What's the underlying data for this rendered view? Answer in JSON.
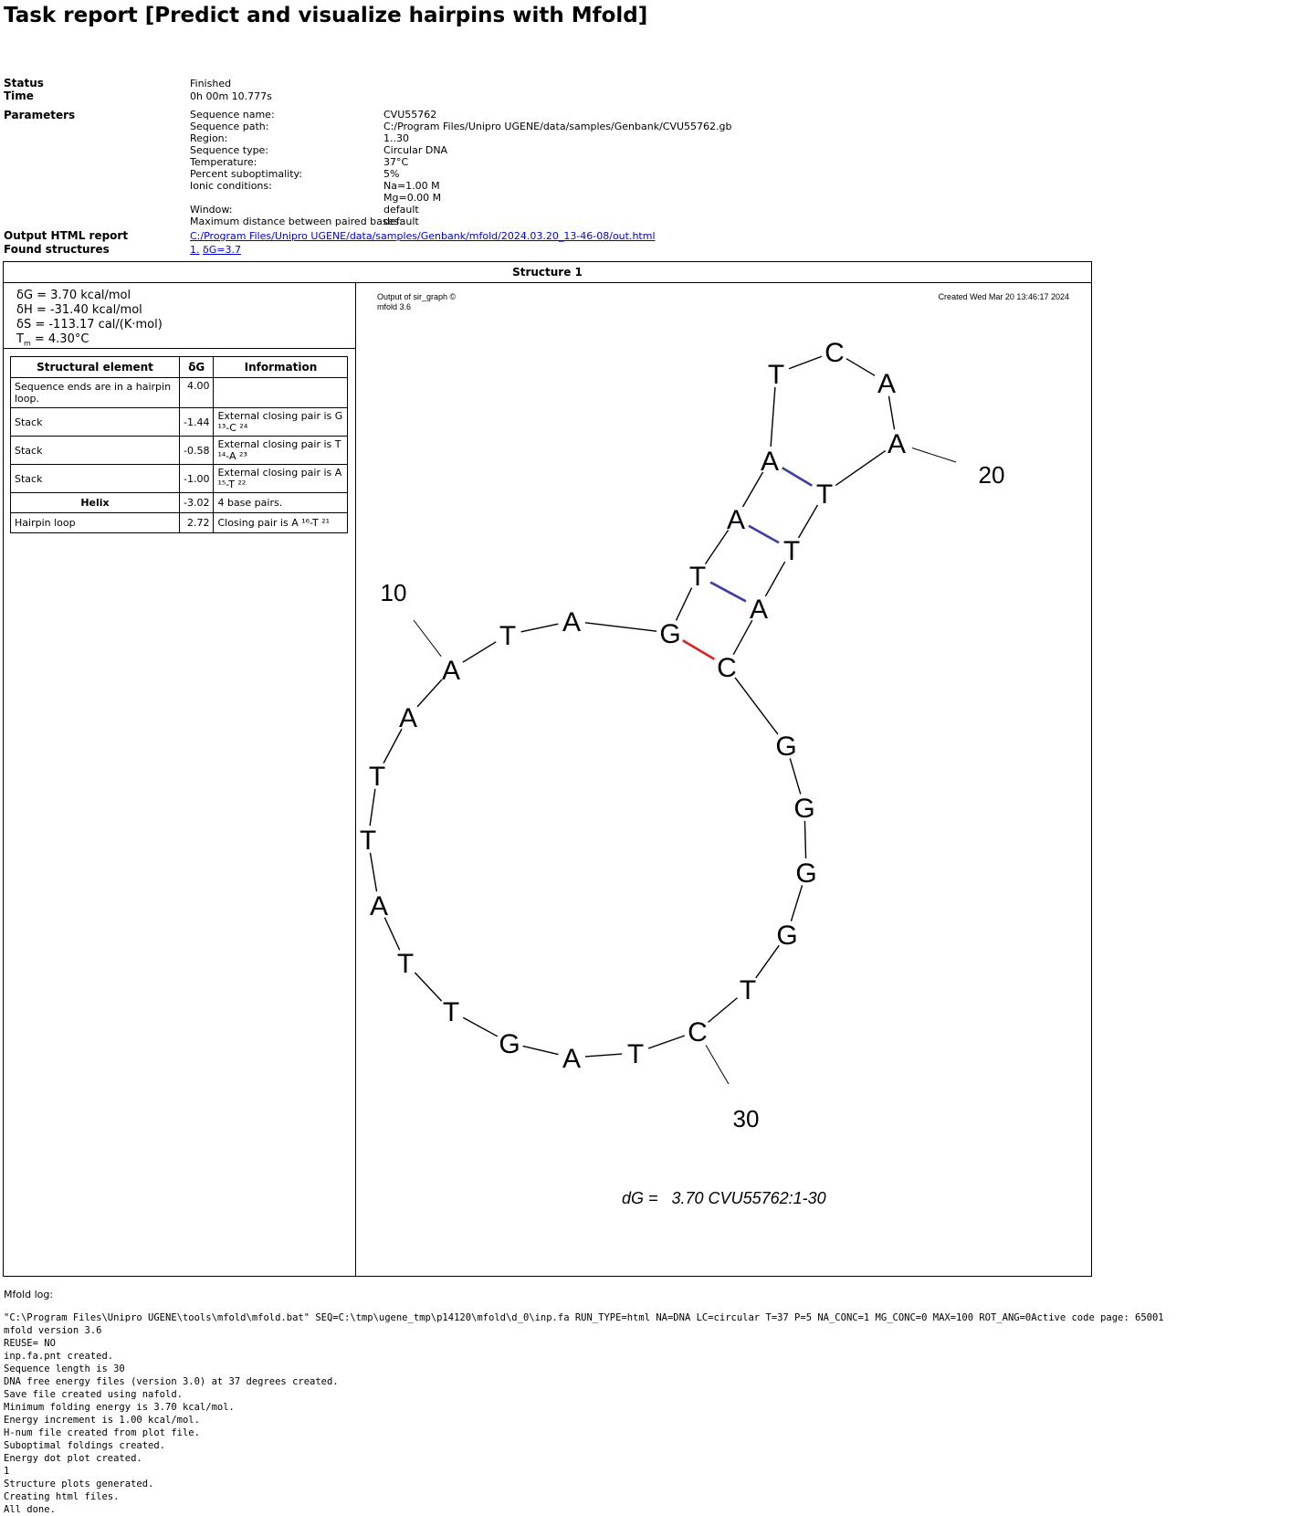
{
  "title": "Task report [Predict and visualize hairpins with Mfold]",
  "status": {
    "label": "Status",
    "value": "Finished"
  },
  "time": {
    "label": "Time",
    "value": "0h 00m 10.777s"
  },
  "parameters": {
    "label": "Parameters",
    "items": [
      {
        "name": "Sequence name:",
        "value": "CVU55762"
      },
      {
        "name": "Sequence path:",
        "value": "C:/Program Files/Unipro UGENE/data/samples/Genbank/CVU55762.gb"
      },
      {
        "name": "Region:",
        "value": "1..30"
      },
      {
        "name": "Sequence type:",
        "value": "Circular DNA"
      },
      {
        "name": "Temperature:",
        "value": "37°C"
      },
      {
        "name": "Percent suboptimality:",
        "value": "5%"
      },
      {
        "name": "Ionic conditions:",
        "value": "Na=1.00 M"
      },
      {
        "name": "",
        "value": "Mg=0.00 M"
      },
      {
        "name": "Window:",
        "value": "default"
      },
      {
        "name": "Maximum distance between paired bases:",
        "value": "default"
      }
    ]
  },
  "output_report": {
    "label": "Output HTML report",
    "link": "C:/Program Files/Unipro UGENE/data/samples/Genbank/mfold/2024.03.20_13-46-08/out.html"
  },
  "found_structures": {
    "label": "Found structures",
    "link_num": "1.",
    "link_dg": "δG=3.7"
  },
  "structure": {
    "header": "Structure 1",
    "thermo": {
      "dg": "δG = 3.70 kcal/mol",
      "dh": "δH = -31.40 kcal/mol",
      "ds": "δS = -113.17 cal/(K·mol)",
      "tm_prefix": "T",
      "tm_sub": "m",
      "tm_value": " = 4.30°C"
    },
    "table": {
      "headers": [
        "Structural element",
        "δG",
        "Information"
      ],
      "rows": [
        {
          "element": "Sequence ends are in a hairpin loop.",
          "dg": "4.00",
          "info": "",
          "bold": false
        },
        {
          "element": "Stack",
          "dg": "-1.44",
          "info": "External closing pair is G ¹³-C ²⁴",
          "bold": false
        },
        {
          "element": "Stack",
          "dg": "-0.58",
          "info": "External closing pair is T ¹⁴-A ²³",
          "bold": false
        },
        {
          "element": "Stack",
          "dg": "-1.00",
          "info": "External closing pair is A ¹⁵-T ²²",
          "bold": false
        },
        {
          "element": "Helix",
          "dg": "-3.02",
          "info": "4 base pairs.",
          "bold": true
        },
        {
          "element": "Hairpin loop",
          "dg": "2.72",
          "info": "Closing pair is A ¹⁶-T ²¹",
          "bold": false
        }
      ]
    },
    "graph": {
      "header_left_1": "Output of sir_graph ©",
      "header_left_2": "mfold 3.6",
      "header_right": "Created Wed Mar 20 13:46:17 2024",
      "footer": "dG =   3.70 CVU55762:1-30",
      "bases": [
        "A",
        "T",
        "G",
        "A",
        "T",
        "T",
        "A",
        "T",
        "T",
        "A",
        "A",
        "T",
        "G",
        "T",
        "A",
        "A",
        "T",
        "C",
        "A",
        "A",
        "T",
        "T",
        "A",
        "C",
        "G",
        "G",
        "G",
        "G",
        "T",
        "C"
      ],
      "position_labels": [
        "10",
        "20",
        "30"
      ],
      "pair_color": "#3c3ca8",
      "closing_pair_color": "#e02020"
    }
  },
  "log": {
    "title": "Mfold log:",
    "lines": [
      "\"C:\\Program Files\\Unipro UGENE\\tools\\mfold\\mfold.bat\" SEQ=C:\\tmp\\ugene_tmp\\p14120\\mfold\\d_0\\inp.fa RUN_TYPE=html NA=DNA LC=circular T=37 P=5 NA_CONC=1 MG_CONC=0 MAX=100 ROT_ANG=0Active code page: 65001",
      "mfold version 3.6",
      "REUSE= NO",
      "inp.fa.pnt created.",
      "Sequence length is 30",
      "DNA free energy files (version 3.0) at 37 degrees created.",
      "Save file created using nafold.",
      "Minimum folding energy is 3.70 kcal/mol.",
      "Energy increment is 1.00 kcal/mol.",
      "H-num file created from plot file.",
      "Suboptimal foldings created.",
      "Energy dot plot created.",
      "1",
      "Structure plots generated.",
      "Creating html files.",
      "All done."
    ]
  }
}
